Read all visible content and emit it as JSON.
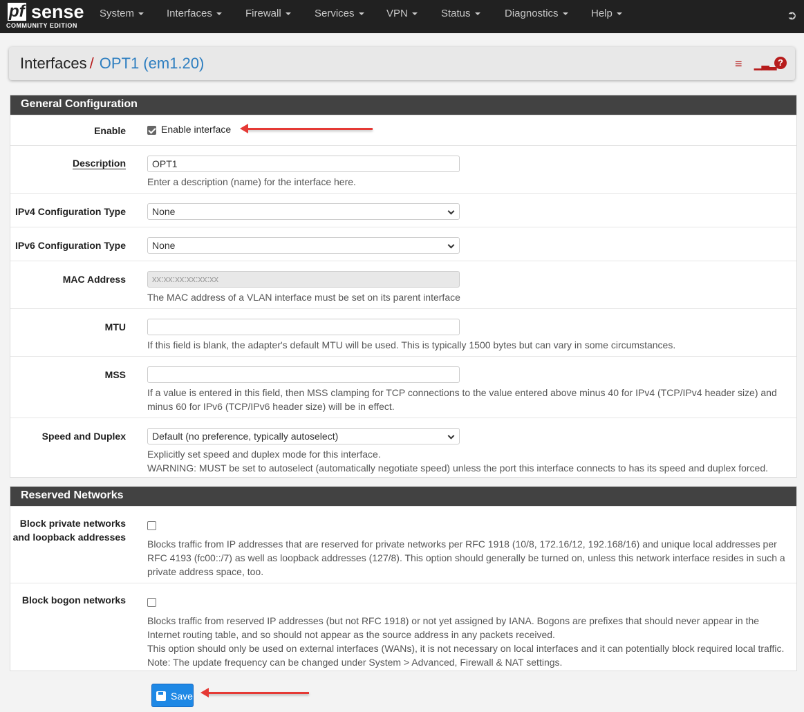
{
  "nav": {
    "logo_main": "pf",
    "logo_sense": "sense",
    "logo_sub": "COMMUNITY EDITION",
    "items": [
      "System",
      "Interfaces",
      "Firewall",
      "Services",
      "VPN",
      "Status",
      "Diagnostics",
      "Help"
    ]
  },
  "breadcrumb": {
    "parent": "Interfaces",
    "separator": "/",
    "current": "OPT1 (em1.20)"
  },
  "general": {
    "title": "General Configuration",
    "enable": {
      "label": "Enable",
      "checkbox_label": "Enable interface",
      "checked": true
    },
    "description": {
      "label": "Description",
      "value": "OPT1",
      "help": "Enter a description (name) for the interface here."
    },
    "ipv4": {
      "label": "IPv4 Configuration Type",
      "value": "None"
    },
    "ipv6": {
      "label": "IPv6 Configuration Type",
      "value": "None"
    },
    "mac": {
      "label": "MAC Address",
      "placeholder": "xx:xx:xx:xx:xx:xx",
      "help": "The MAC address of a VLAN interface must be set on its parent interface"
    },
    "mtu": {
      "label": "MTU",
      "value": "",
      "help": "If this field is blank, the adapter's default MTU will be used. This is typically 1500 bytes but can vary in some circumstances."
    },
    "mss": {
      "label": "MSS",
      "value": "",
      "help": "If a value is entered in this field, then MSS clamping for TCP connections to the value entered above minus 40 for IPv4 (TCP/IPv4 header size) and minus 60 for IPv6 (TCP/IPv6 header size) will be in effect."
    },
    "speed": {
      "label": "Speed and Duplex",
      "value": "Default (no preference, typically autoselect)",
      "help1": "Explicitly set speed and duplex mode for this interface.",
      "help2": "WARNING: MUST be set to autoselect (automatically negotiate speed) unless the port this interface connects to has its speed and duplex forced."
    }
  },
  "reserved": {
    "title": "Reserved Networks",
    "private": {
      "label_line1": "Block private networks",
      "label_line2": "and loopback addresses",
      "checked": false,
      "help": "Blocks traffic from IP addresses that are reserved for private networks per RFC 1918 (10/8, 172.16/12, 192.168/16) and unique local addresses per RFC 4193 (fc00::/7) as well as loopback addresses (127/8). This option should generally be turned on, unless this network interface resides in such a private address space, too."
    },
    "bogon": {
      "label": "Block bogon networks",
      "checked": false,
      "help1": "Blocks traffic from reserved IP addresses (but not RFC 1918) or not yet assigned by IANA. Bogons are prefixes that should never appear in the Internet routing table, and so should not appear as the source address in any packets received.",
      "help2": "This option should only be used on external interfaces (WANs), it is not necessary on local interfaces and it can potentially block required local traffic.",
      "help3": "Note: The update frequency can be changed under System > Advanced, Firewall & NAT settings."
    }
  },
  "save_label": "Save"
}
